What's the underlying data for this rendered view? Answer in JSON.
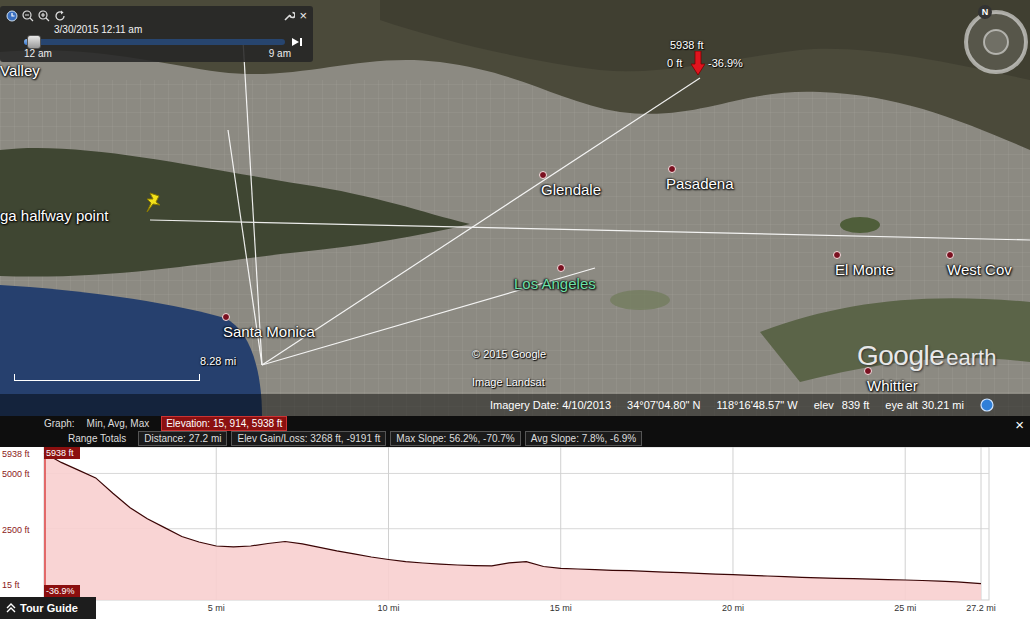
{
  "time_slider": {
    "date": "3/30/2015  12:11 am",
    "start": "12 am",
    "end": "9 am",
    "level": 0.04,
    "close": "×"
  },
  "compass": {
    "north": "N"
  },
  "map": {
    "places": [
      {
        "name": "Valley",
        "color": "#ffffff"
      },
      {
        "name": "Glendale",
        "color": "#ffffff"
      },
      {
        "name": "Pasadena",
        "color": "#ffffff"
      },
      {
        "name": "Los Angeles",
        "color": "#6fe0a8"
      },
      {
        "name": "Santa Monica",
        "color": "#ffffff"
      },
      {
        "name": "El Monte",
        "color": "#ffffff"
      },
      {
        "name": "West Cov",
        "color": "#ffffff"
      },
      {
        "name": "Whittier",
        "color": "#ffffff"
      }
    ],
    "pin": {
      "label": "ga halfway point"
    },
    "marker": {
      "elevation": "5938 ft",
      "offset": "0 ft",
      "slope": "-36.9%"
    },
    "scale": {
      "label": "8.28 mi"
    },
    "copyright": "© 2015 Google",
    "imagery_credit": "Image Landsat",
    "logo": {
      "word1": "Google",
      "word2": "earth"
    }
  },
  "status_bar": {
    "imagery_date": "Imagery Date: 4/10/2013",
    "lat": "34°07'04.80\" N",
    "lon": "118°16'48.57\" W",
    "elev_label": "elev",
    "elev": "839 ft",
    "eye_alt_label": "eye alt",
    "eye_alt": "30.21 mi"
  },
  "graph": {
    "label": "Graph:",
    "modes": [
      {
        "label": "Min, Avg, Max",
        "selected": false
      },
      {
        "label": "Elevation: 15, 914, 5938 ft",
        "selected": true
      }
    ],
    "range_label": "Range Totals",
    "totals": [
      "Distance: 27.2 mi",
      "Elev Gain/Loss: 3268 ft, -9191 ft",
      "Max Slope: 56.2%, -70.7%",
      "Avg Slope: 7.8%, -6.9%"
    ],
    "close": "×",
    "y_ticks": [
      {
        "label": "5938 ft",
        "value": 5938
      },
      {
        "label": "5000 ft",
        "value": 5000
      },
      {
        "label": "2500 ft",
        "value": 2500
      },
      {
        "label": "15 ft",
        "value": 15
      }
    ],
    "x_ticks": [
      {
        "label": "5 mi",
        "value": 5
      },
      {
        "label": "10 mi",
        "value": 10
      },
      {
        "label": "15 mi",
        "value": 15
      },
      {
        "label": "20 mi",
        "value": 20
      },
      {
        "label": "25 mi",
        "value": 25
      },
      {
        "label": "27.2 mi",
        "value": 27.2
      }
    ],
    "cursor": {
      "elevation": "5938 ft",
      "slope": "-36.9%"
    },
    "series": [
      {
        "name": "Elevation",
        "distance": [
          0,
          0.5,
          1,
          1.5,
          2,
          2.5,
          3,
          3.5,
          4,
          4.5,
          5,
          5.5,
          6,
          6.5,
          7,
          7.5,
          8,
          8.5,
          9,
          9.5,
          10,
          10.5,
          11,
          11.5,
          12,
          12.5,
          13,
          13.5,
          14,
          14.5,
          15,
          15.5,
          16,
          16.5,
          17,
          17.5,
          18,
          18.5,
          19,
          19.5,
          20,
          20.5,
          21,
          21.5,
          22,
          22.5,
          23,
          23.5,
          24,
          24.5,
          25,
          25.5,
          26,
          26.5,
          27,
          27.2
        ],
        "values": [
          5938,
          5500,
          5150,
          4800,
          4100,
          3450,
          2950,
          2550,
          2150,
          1900,
          1720,
          1680,
          1720,
          1830,
          1920,
          1820,
          1660,
          1500,
          1360,
          1220,
          1110,
          1010,
          950,
          900,
          860,
          830,
          820,
          960,
          1010,
          790,
          710,
          680,
          650,
          620,
          600,
          570,
          540,
          510,
          480,
          450,
          420,
          390,
          360,
          330,
          300,
          280,
          260,
          240,
          220,
          200,
          180,
          160,
          130,
          100,
          40,
          15
        ]
      }
    ]
  },
  "tour_guide": {
    "label": "Tour Guide"
  }
}
